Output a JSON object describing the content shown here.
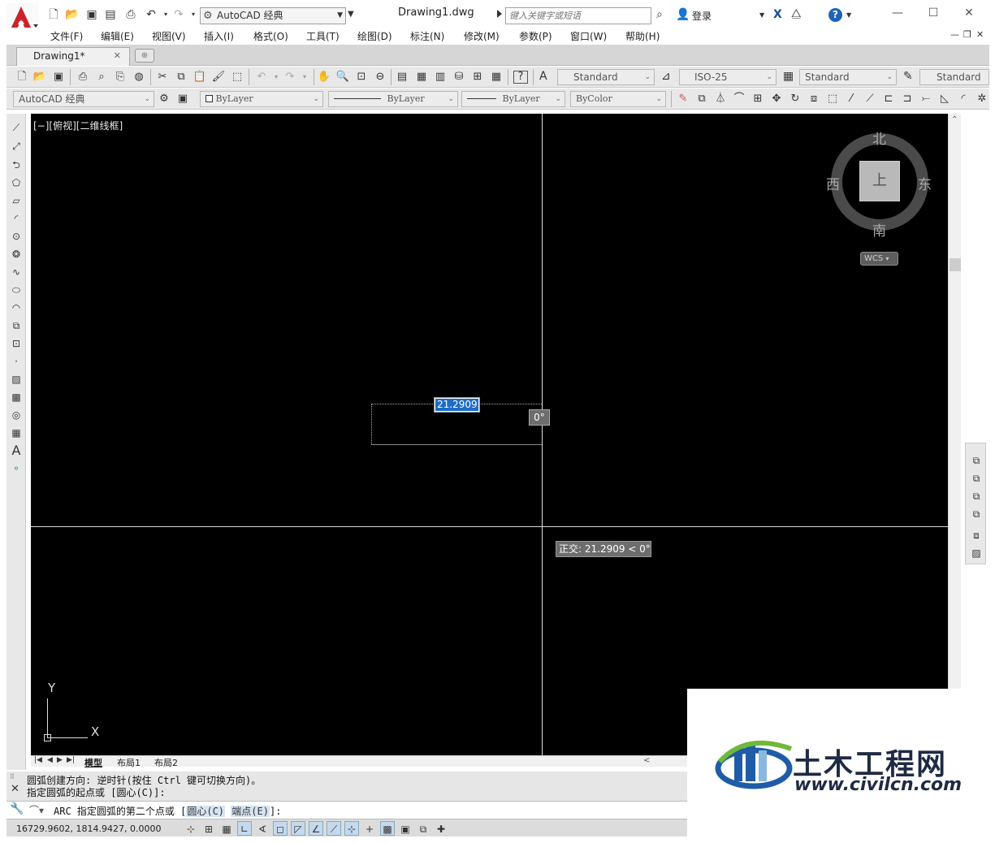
{
  "titlebar": {
    "workspace": "AutoCAD 经典",
    "document": "Drawing1.dwg",
    "search_placeholder": "键入关键字或短语",
    "login": "登录"
  },
  "menu": [
    "文件(F)",
    "编辑(E)",
    "视图(V)",
    "插入(I)",
    "格式(O)",
    "工具(T)",
    "绘图(D)",
    "标注(N)",
    "修改(M)",
    "参数(P)",
    "窗口(W)",
    "帮助(H)"
  ],
  "tabs": {
    "active": "Drawing1*"
  },
  "styles_toolbar": {
    "text_style": "Standard",
    "dim_style": "ISO-25",
    "table_style": "Standard",
    "mleader_style": "Standard"
  },
  "props_toolbar": {
    "workspace": "AutoCAD 经典",
    "layer": "ByLayer",
    "linetype": "ByLayer",
    "lineweight": "ByLayer",
    "color": "ByColor"
  },
  "canvas": {
    "viewport_label": "[−][俯视][二维线框]",
    "length_input": "21.2909",
    "angle_input": "0°",
    "ortho_tooltip": "正交: 21.2909 < 0°",
    "viewcube": {
      "north": "北",
      "south": "南",
      "west": "西",
      "east": "东",
      "face": "上",
      "wcs": "WCS"
    },
    "ucs": {
      "x": "X",
      "y": "Y"
    }
  },
  "layout_tabs": [
    "模型",
    "布局1",
    "布局2"
  ],
  "command": {
    "history": [
      "圆弧创建方向: 逆时针(按住 Ctrl 键可切换方向)。",
      "指定圆弧的起点或 [圆心(C)]:"
    ],
    "prompt_prefix": "ARC 指定圆弧的第二个点或 [",
    "option_center": "圆心(C)",
    "option_end": "端点(E)",
    "prompt_suffix": "]:"
  },
  "status": {
    "coordinates": "16729.9602, 1814.9427, 0.0000"
  },
  "watermark": {
    "title": "土木工程网",
    "url": "www.civilcn.com"
  },
  "colors": {
    "canvas_bg": "#000000",
    "selection_blue": "#1f6bc6",
    "brand_red": "#c8242b"
  }
}
